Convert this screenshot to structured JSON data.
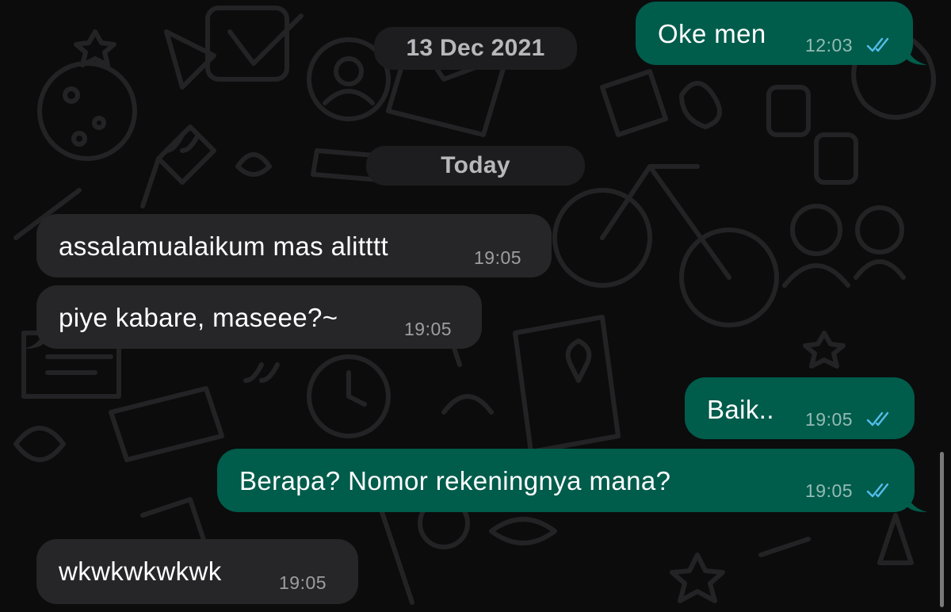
{
  "date_separators": {
    "previous": "13 Dec 2021",
    "today": "Today"
  },
  "messages": [
    {
      "direction": "outgoing",
      "text": "Oke men",
      "time": "12:03",
      "status": "read"
    },
    {
      "direction": "incoming",
      "text": "assalamualaikum mas alitttt",
      "time": "19:05"
    },
    {
      "direction": "incoming",
      "text": "piye kabare, maseee?~",
      "time": "19:05"
    },
    {
      "direction": "outgoing",
      "text": "Baik..",
      "time": "19:05",
      "status": "read"
    },
    {
      "direction": "outgoing",
      "text": "Berapa? Nomor rekeningnya mana?",
      "time": "19:05",
      "status": "read"
    },
    {
      "direction": "incoming",
      "text": "wkwkwkwkwk",
      "time": "19:05"
    }
  ],
  "colors": {
    "background": "#0c0c0c",
    "incoming_bubble": "#262628",
    "outgoing_bubble": "#005c4b",
    "read_tick": "#53bdeb"
  },
  "icons": [
    "read-receipt-double-check-icon"
  ]
}
